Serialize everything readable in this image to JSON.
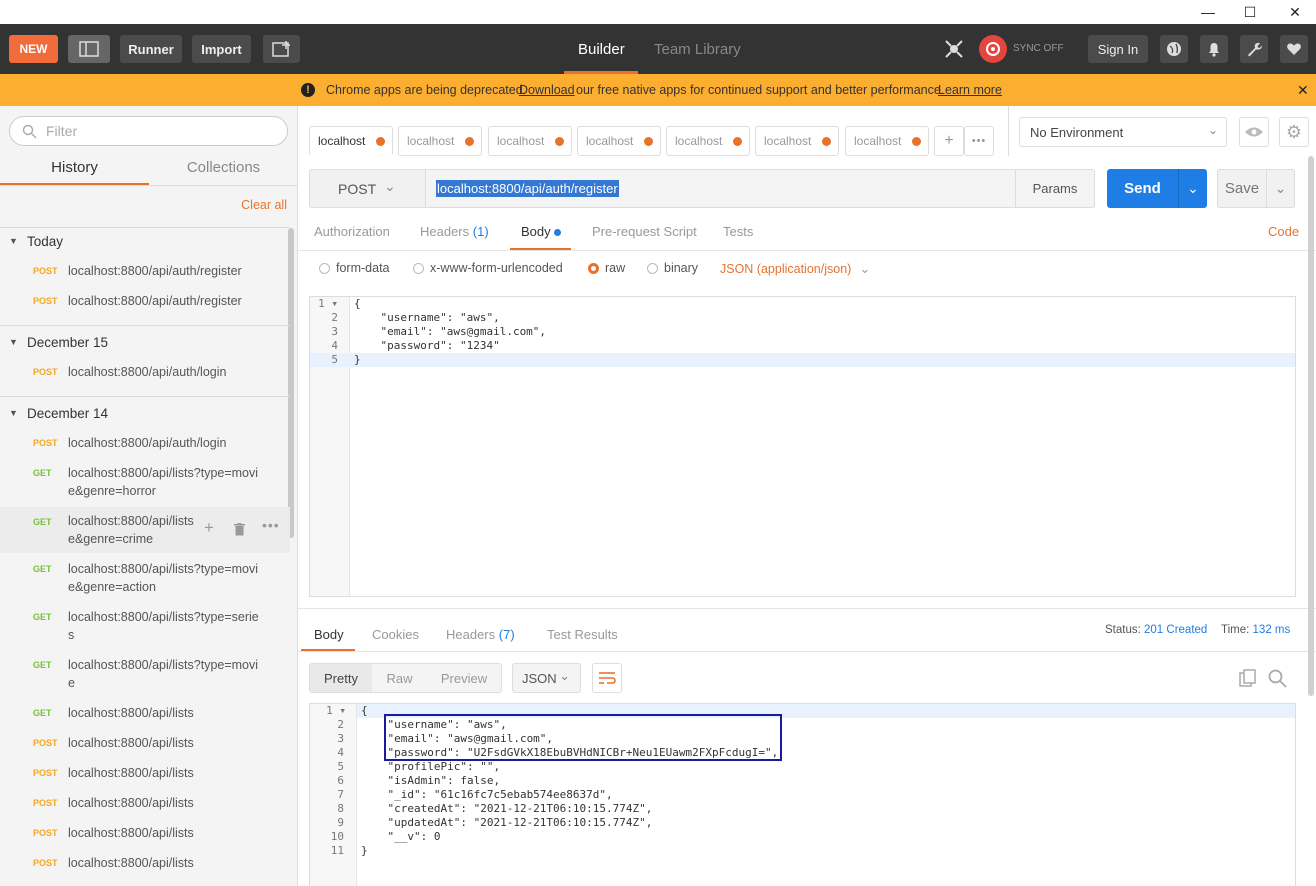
{
  "window": {
    "minimize": "—",
    "maximize": "☐",
    "close": "✕"
  },
  "header": {
    "new_label": "NEW",
    "runner_label": "Runner",
    "import_label": "Import",
    "builder_label": "Builder",
    "team_library_label": "Team Library",
    "sync_label": "SYNC OFF",
    "sign_in_label": "Sign In"
  },
  "banner": {
    "text_before": "Chrome apps are being deprecated.",
    "download_link": "Download",
    "text_after": "our free native apps for continued support and better performance.",
    "learn_more": "Learn more"
  },
  "sidebar": {
    "filter_placeholder": "Filter",
    "tab_history": "History",
    "tab_collections": "Collections",
    "clear_all": "Clear all",
    "groups": [
      {
        "title": "Today"
      },
      {
        "title": "December 15"
      },
      {
        "title": "December 14"
      }
    ],
    "items": [
      {
        "method": "POST",
        "url": "localhost:8800/api/auth/register"
      },
      {
        "method": "POST",
        "url": "localhost:8800/api/auth/register"
      },
      {
        "method": "POST",
        "url": "localhost:8800/api/auth/login"
      },
      {
        "method": "POST",
        "url": "localhost:8800/api/auth/login"
      },
      {
        "method": "GET",
        "url": "localhost:8800/api/lists?type=movie&genre=horror"
      },
      {
        "method": "GET",
        "url": "localhost:8800/api/lists e&genre=crime"
      },
      {
        "method": "GET",
        "url": "localhost:8800/api/lists?type=movie&genre=action"
      },
      {
        "method": "GET",
        "url": "localhost:8800/api/lists?type=series"
      },
      {
        "method": "GET",
        "url": "localhost:8800/api/lists?type=movie"
      },
      {
        "method": "GET",
        "url": "localhost:8800/api/lists"
      },
      {
        "method": "POST",
        "url": "localhost:8800/api/lists"
      },
      {
        "method": "POST",
        "url": "localhost:8800/api/lists"
      },
      {
        "method": "POST",
        "url": "localhost:8800/api/lists"
      },
      {
        "method": "POST",
        "url": "localhost:8800/api/lists"
      },
      {
        "method": "POST",
        "url": "localhost:8800/api/lists"
      }
    ]
  },
  "tabs": [
    "localhost",
    "localhost",
    "localhost",
    "localhost",
    "localhost",
    "localhost",
    "localhost"
  ],
  "environment": {
    "selected": "No Environment"
  },
  "request": {
    "method": "POST",
    "url": "localhost:8800/api/auth/register",
    "params_label": "Params",
    "send_label": "Send",
    "save_label": "Save",
    "subtabs": {
      "authorization": "Authorization",
      "headers": "Headers",
      "headers_count": "(1)",
      "body": "Body",
      "pre_request": "Pre-request Script",
      "tests": "Tests",
      "code": "Code"
    },
    "body_modes": {
      "form_data": "form-data",
      "urlencoded": "x-www-form-urlencoded",
      "raw": "raw",
      "binary": "binary",
      "content_type": "JSON (application/json)"
    },
    "body_lines": [
      "{",
      "    \"username\": \"aws\",",
      "    \"email\": \"aws@gmail.com\",",
      "    \"password\": \"1234\"",
      "}"
    ]
  },
  "response": {
    "tabs": {
      "body": "Body",
      "cookies": "Cookies",
      "headers": "Headers",
      "headers_count": "(7)",
      "test_results": "Test Results"
    },
    "status_label": "Status:",
    "status_value": "201 Created",
    "time_label": "Time:",
    "time_value": "132 ms",
    "view_modes": {
      "pretty": "Pretty",
      "raw": "Raw",
      "preview": "Preview",
      "format": "JSON"
    },
    "body_lines": [
      "{",
      "    \"username\": \"aws\",",
      "    \"email\": \"aws@gmail.com\",",
      "    \"password\": \"U2FsdGVkX18EbuBVHdNICBr+Neu1EUawm2FXpFcdugI=\",",
      "    \"profilePic\": \"\",",
      "    \"isAdmin\": false,",
      "    \"_id\": \"61c16fc7c5ebab574ee8637d\",",
      "    \"createdAt\": \"2021-12-21T06:10:15.774Z\",",
      "    \"updatedAt\": \"2021-12-21T06:10:15.774Z\",",
      "    \"__v\": 0",
      "}"
    ]
  },
  "colors": {
    "accent": "#e8722c",
    "send": "#1f7ee6",
    "banner": "#fcae30",
    "header": "#333333"
  }
}
